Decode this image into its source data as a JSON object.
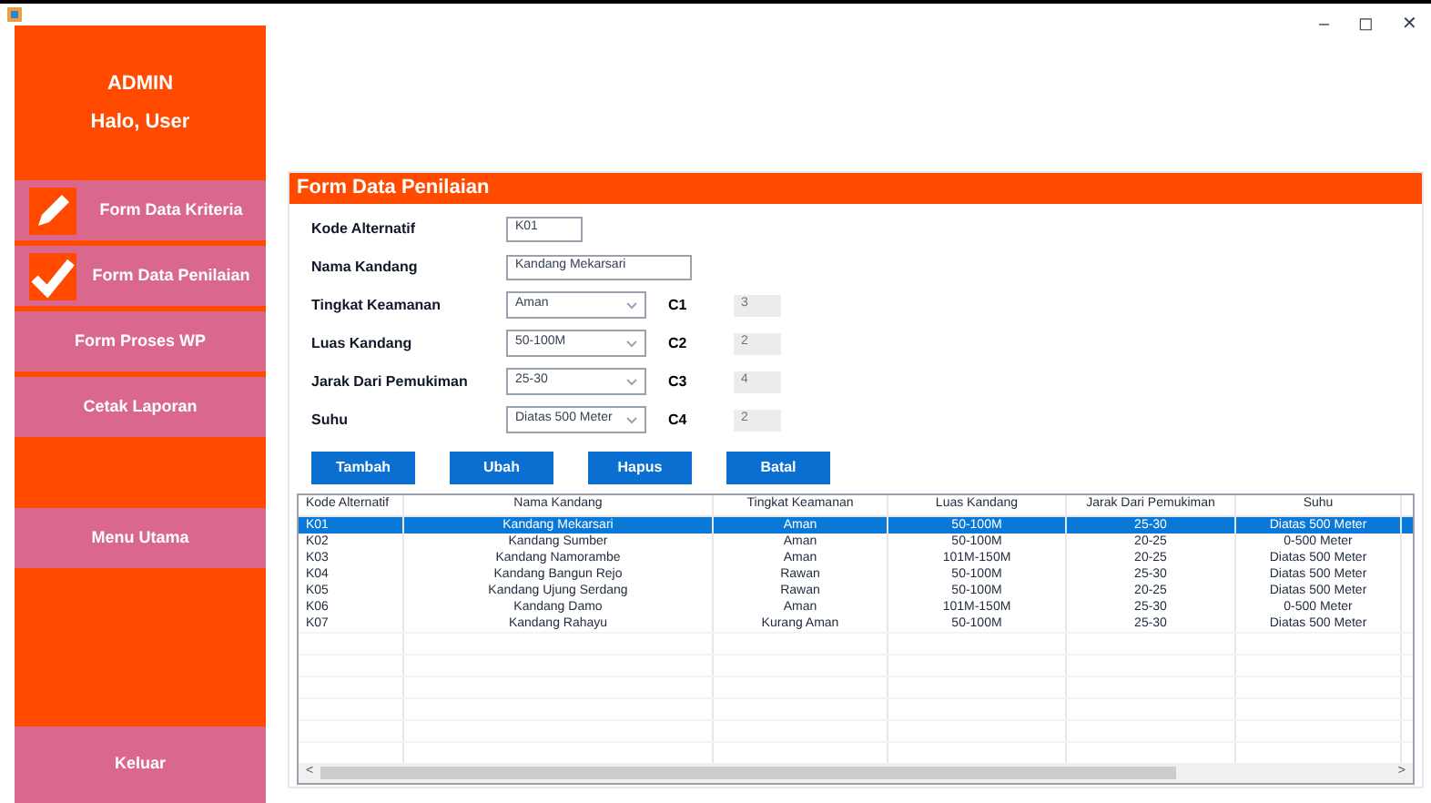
{
  "window": {
    "controls": [
      "–",
      "◻",
      "✕"
    ]
  },
  "sidebar": {
    "title": "ADMIN",
    "greeting": "Halo, User",
    "items": [
      {
        "label": "Form Data Kriteria",
        "kind": "pencil"
      },
      {
        "label": "Form Data Penilaian",
        "kind": "check"
      },
      {
        "label": "Form Proses WP",
        "kind": "menu"
      },
      {
        "label": "Cetak Laporan",
        "kind": "menu"
      },
      {
        "kind": "spacer"
      },
      {
        "label": "Menu Utama",
        "kind": "menu"
      },
      {
        "kind": "spacer"
      },
      {
        "label": "Keluar",
        "kind": "menu"
      }
    ]
  },
  "form": {
    "title": "Form Data Penilaian",
    "fields": [
      {
        "label": "Kode Alternatif",
        "kind": "text",
        "value": "K01"
      },
      {
        "label": "Nama Kandang",
        "kind": "text",
        "value": "Kandang Mekarsari"
      },
      {
        "label": "Tingkat Keamanan",
        "kind": "select",
        "value": "Aman",
        "code": "C1",
        "score": "3"
      },
      {
        "label": "Luas Kandang",
        "kind": "select",
        "value": "50-100M",
        "code": "C2",
        "score": "2"
      },
      {
        "label": "Jarak Dari Pemukiman",
        "kind": "select",
        "value": "25-30",
        "code": "C3",
        "score": "4"
      },
      {
        "label": "Suhu",
        "kind": "select",
        "value": "Diatas 500 Meter",
        "code": "C4",
        "score": "2"
      }
    ],
    "buttons": [
      "Tambah",
      "Ubah",
      "Hapus",
      "Batal"
    ]
  },
  "table": {
    "columns": [
      "Kode Alternatif",
      "Nama Kandang",
      "Tingkat Keamanan",
      "Luas Kandang",
      "Jarak Dari Pemukiman",
      "Suhu"
    ],
    "rows": [
      {
        "selected": true,
        "cells": [
          "K01",
          "Kandang Mekarsari",
          "Aman",
          "50-100M",
          "25-30",
          "Diatas 500 Meter"
        ]
      },
      {
        "selected": false,
        "cells": [
          "K02",
          "Kandang Sumber",
          "Aman",
          "50-100M",
          "20-25",
          "0-500 Meter"
        ]
      },
      {
        "selected": false,
        "cells": [
          "K03",
          "Kandang Namorambe",
          "Aman",
          "101M-150M",
          "20-25",
          "Diatas 500 Meter"
        ]
      },
      {
        "selected": false,
        "cells": [
          "K04",
          "Kandang Bangun Rejo",
          "Rawan",
          "50-100M",
          "25-30",
          "Diatas 500 Meter"
        ]
      },
      {
        "selected": false,
        "cells": [
          "K05",
          "Kandang Ujung Serdang",
          "Rawan",
          "50-100M",
          "20-25",
          "Diatas 500 Meter"
        ]
      },
      {
        "selected": false,
        "cells": [
          "K06",
          "Kandang Damo",
          "Aman",
          "101M-150M",
          "25-30",
          "0-500 Meter"
        ]
      },
      {
        "selected": false,
        "cells": [
          "K07",
          "Kandang Rahayu",
          "Kurang Aman",
          "50-100M",
          "25-30",
          "Diatas 500 Meter"
        ]
      }
    ],
    "scroll_left": "<",
    "scroll_right": ">"
  }
}
